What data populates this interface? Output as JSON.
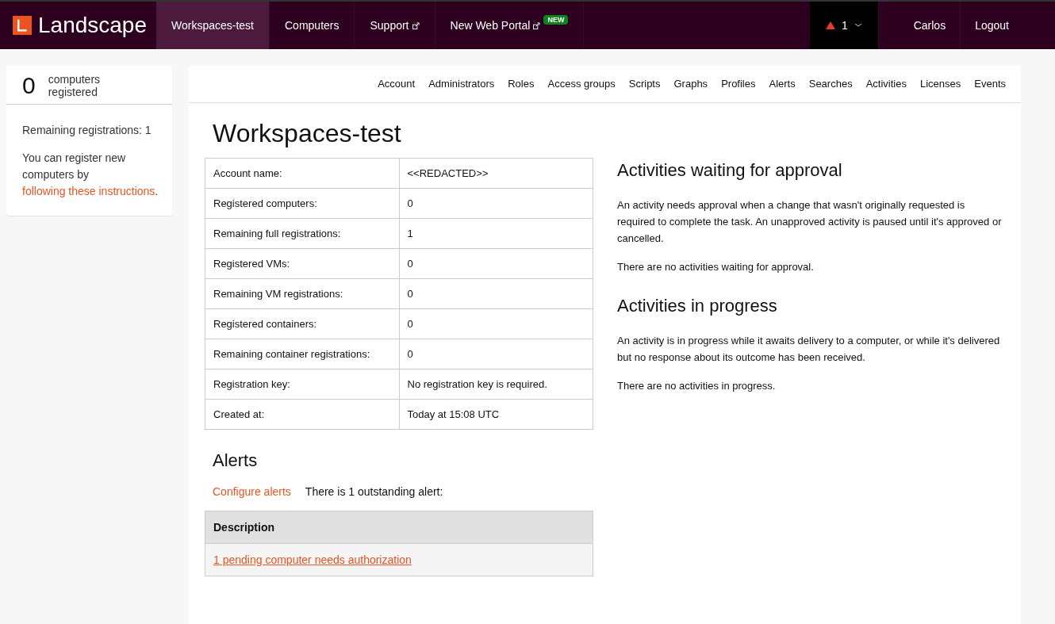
{
  "top_nav": {
    "brand": "Landscape",
    "items": [
      {
        "label": "Workspaces-test",
        "selected": true,
        "external": false
      },
      {
        "label": "Computers",
        "selected": false,
        "external": false
      },
      {
        "label": "Support",
        "selected": false,
        "external": true
      },
      {
        "label": "New Web Portal",
        "selected": false,
        "external": true,
        "badge": "NEW"
      }
    ],
    "alert_count": "1",
    "user": "Carlos",
    "logout": "Logout"
  },
  "sidebar": {
    "count": "0",
    "count_label": "computers registered",
    "remaining": "Remaining registrations: 1",
    "register_before": "You can register new computers by",
    "register_link": "following these instructions",
    "register_after": "."
  },
  "sub_nav": [
    {
      "label": "Account",
      "selected": false
    },
    {
      "label": "Administrators",
      "selected": false
    },
    {
      "label": "Roles",
      "selected": false
    },
    {
      "label": "Access groups",
      "selected": false
    },
    {
      "label": "Scripts",
      "selected": false
    },
    {
      "label": "Graphs",
      "selected": false
    },
    {
      "label": "Profiles",
      "selected": false
    },
    {
      "label": "Alerts",
      "selected": false
    },
    {
      "label": "Searches",
      "selected": false
    },
    {
      "label": "Activities",
      "selected": false
    },
    {
      "label": "Licenses",
      "selected": false
    },
    {
      "label": "Events",
      "selected": false
    }
  ],
  "title": "Workspaces-test",
  "account_table": [
    {
      "label": "Account name:",
      "value": "<<REDACTED>>"
    },
    {
      "label": "Registered computers:",
      "value": "0"
    },
    {
      "label": "Remaining full registrations:",
      "value": "1"
    },
    {
      "label": "Registered VMs:",
      "value": "0"
    },
    {
      "label": "Remaining VM registrations:",
      "value": "0"
    },
    {
      "label": "Registered containers:",
      "value": "0"
    },
    {
      "label": "Remaining container registrations:",
      "value": "0"
    },
    {
      "label": "Registration key:",
      "value": "No registration key is required."
    },
    {
      "label": "Created at:",
      "value": "Today at 15:08 UTC"
    }
  ],
  "alerts": {
    "heading": "Alerts",
    "configure_link": "Configure alerts",
    "summary": "There is 1 outstanding alert:",
    "column": "Description",
    "rows": [
      {
        "text": "1 pending computer needs authorization"
      }
    ]
  },
  "activity_sections": [
    {
      "heading": "Activities waiting for approval",
      "description": "An activity needs approval when a change that wasn't originally requested is required to complete the task. An unapproved activity is paused until it's approved or cancelled.",
      "empty": "There are no activities waiting for approval."
    },
    {
      "heading": "Activities in progress",
      "description": "An activity is in progress while it awaits delivery to a computer, or while it's delivered but no response about its outcome has been received.",
      "empty": "There are no activities in progress."
    }
  ]
}
